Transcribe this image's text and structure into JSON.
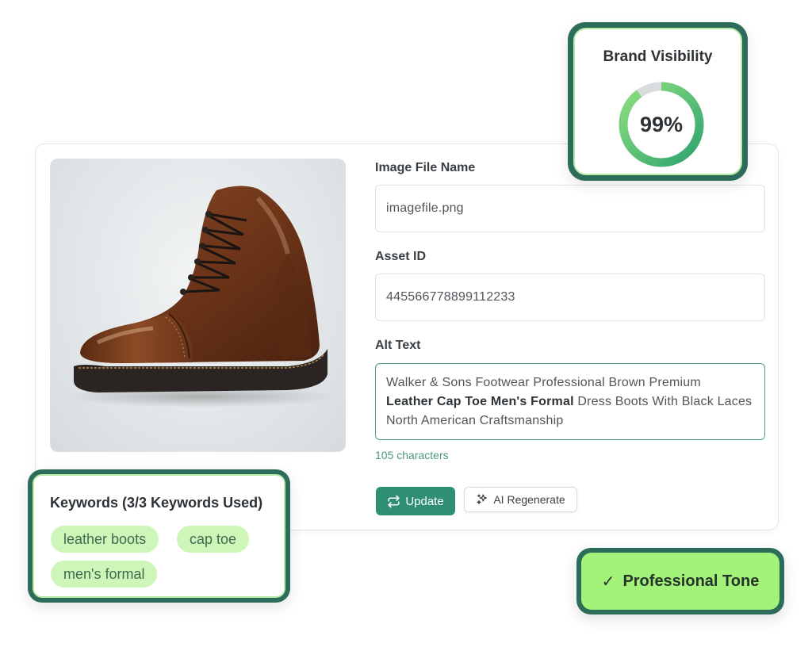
{
  "brand": {
    "title": "Brand Visibility",
    "value_label": "99%",
    "percent": 99,
    "ring_color": "#2ea36f",
    "ring_color_light": "#8fe07f",
    "track_color": "#d9dcdf"
  },
  "form": {
    "file_name_label": "Image File Name",
    "file_name_value": "imagefile.png",
    "asset_id_label": "Asset ID",
    "asset_id_value": "445566778899112233",
    "alt_text_label": "Alt Text",
    "alt_text": {
      "part1": "Walker & Sons Footwear Professional Brown Premium",
      "bold": "Leather Cap Toe Men's Formal",
      "part2": " Dress Boots With Black Laces North American Craftsmanship"
    },
    "char_count": "105 characters",
    "update_label": "Update",
    "ai_regenerate_label": "AI Regenerate"
  },
  "keywords": {
    "title": "Keywords (3/3 Keywords Used)",
    "items": [
      "leather boots",
      "cap toe",
      "men's formal"
    ]
  },
  "tone": {
    "check": "✓",
    "label": "Professional Tone"
  },
  "colors": {
    "accent": "#2e8f73",
    "card_border": "#2d6b5a",
    "chip_bg": "#cdf6b8",
    "tone_bg": "#a3f279"
  }
}
